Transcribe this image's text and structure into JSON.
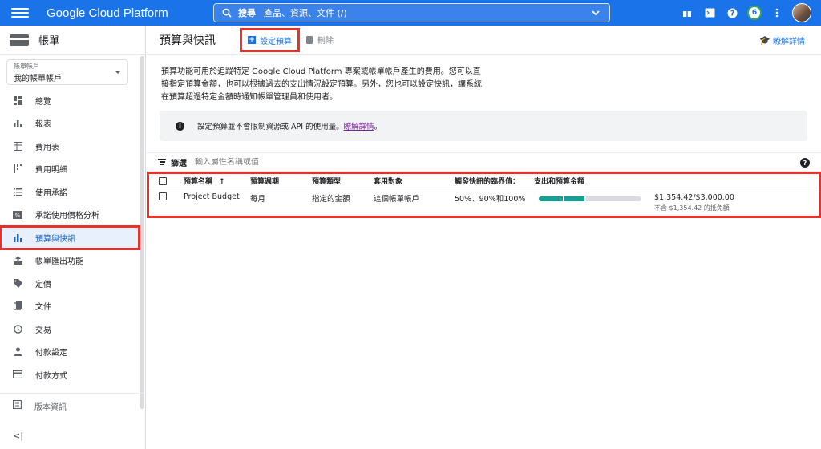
{
  "topbar": {
    "brand": "Google Cloud Platform",
    "search_label": "搜尋",
    "search_placeholder": "產品、資源、文件 (/)",
    "notification_count": "6"
  },
  "sidebar": {
    "title": "帳單",
    "account_label": "帳單帳戶",
    "account_value": "我的帳單帳戶",
    "items": [
      {
        "label": "總覽",
        "icon": "overview-icon"
      },
      {
        "label": "報表",
        "icon": "bar-chart-icon"
      },
      {
        "label": "費用表",
        "icon": "table-icon"
      },
      {
        "label": "費用明細",
        "icon": "breakdown-icon"
      },
      {
        "label": "使用承諾",
        "icon": "list-icon"
      },
      {
        "label": "承諾使用價格分析",
        "icon": "percent-icon"
      },
      {
        "label": "預算與快訊",
        "icon": "budget-icon",
        "active": true
      },
      {
        "label": "帳單匯出功能",
        "icon": "export-icon"
      },
      {
        "label": "定價",
        "icon": "tag-icon"
      },
      {
        "label": "文件",
        "icon": "document-icon"
      },
      {
        "label": "交易",
        "icon": "clock-icon"
      },
      {
        "label": "付款設定",
        "icon": "person-icon"
      },
      {
        "label": "付款方式",
        "icon": "credit-card-icon"
      }
    ],
    "footer_label": "版本資訊",
    "collapse_label": "<|"
  },
  "main": {
    "title": "預算與快訊",
    "create_label": "設定預算",
    "delete_label": "刪除",
    "learn_more_label": "瞭解詳情",
    "description": "預算功能可用於追蹤特定 Google Cloud Platform 專案或帳單帳戶產生的費用。您可以直接指定預算金額，也可以根據過去的支出情況設定預算。另外，您也可以設定快訊，讓系統在預算超過特定金額時通知帳單管理員和使用者。",
    "info_text": "設定預算並不會限制資源或 API 的使用量。",
    "info_link": "瞭解詳情",
    "info_suffix": "。",
    "filter_label": "篩選",
    "filter_placeholder": "輸入屬性名稱或值"
  },
  "table": {
    "headers": {
      "name": "預算名稱",
      "period": "預算週期",
      "type": "預算類型",
      "scope": "套用對象",
      "thresholds": "觸發快訊的臨界值：",
      "spend": "支出和預算金額"
    },
    "rows": [
      {
        "name": "Project Budget",
        "period": "每月",
        "type": "指定的金額",
        "scope": "這個帳單帳戶",
        "thresholds": "50%、90%和100%",
        "spend_fraction": 0.45,
        "amount": "$1,354.42/$3,000.00",
        "note": "不含 $1,354.42 的抵免額"
      }
    ]
  }
}
